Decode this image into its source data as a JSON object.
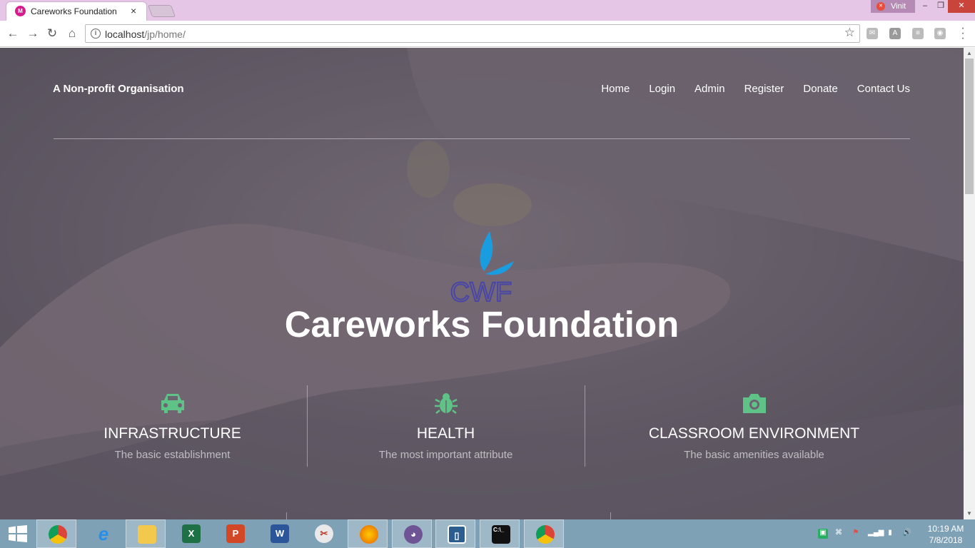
{
  "browser": {
    "tab_title": "Careworks Foundation",
    "tab_close": "×",
    "user_name": "Vinit",
    "url_host": "localhost",
    "url_path": "/jp/home/"
  },
  "site": {
    "brand": "A Non-profit Organisation",
    "nav": [
      "Home",
      "Login",
      "Admin",
      "Register",
      "Donate",
      "Contact Us"
    ],
    "logo_text": "CWF",
    "title": "Careworks Foundation",
    "accent_color": "#5fc287",
    "features": [
      {
        "icon": "car-icon",
        "title": "INFRASTRUCTURE",
        "subtitle": "The basic establishment"
      },
      {
        "icon": "bug-icon",
        "title": "HEALTH",
        "subtitle": "The most important attribute"
      },
      {
        "icon": "camera-icon",
        "title": "CLASSROOM ENVIRONMENT",
        "subtitle": "The basic amenities available"
      }
    ]
  },
  "taskbar": {
    "apps": [
      "start",
      "chrome",
      "internet-explorer",
      "file-explorer",
      "excel",
      "powerpoint",
      "word",
      "snipping-tool",
      "firefox",
      "github",
      "remote-app",
      "command-prompt",
      "chrome"
    ],
    "time": "10:19 AM",
    "date": "7/8/2018"
  }
}
